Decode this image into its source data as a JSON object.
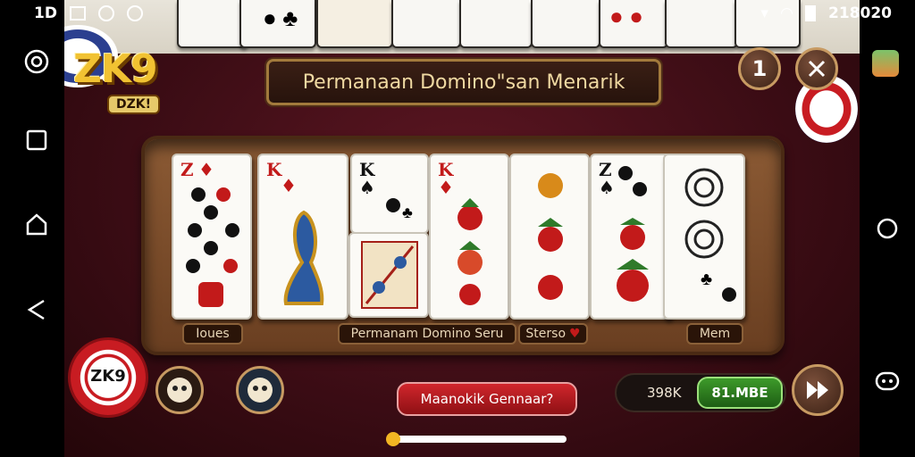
{
  "status_bar": {
    "left_text": "1D",
    "time": "218020"
  },
  "logo": {
    "main": "ZK9",
    "sub": "DZK!"
  },
  "title": "Permanaan Domino\"san Menarik",
  "top_right": {
    "number_button": "1"
  },
  "board_labels": {
    "left": "Ioues",
    "center": "Permanam Domino Seru",
    "center_right": "Sterso",
    "right": "Mem"
  },
  "dominoes": [
    {
      "rank": "Z",
      "suit": "♦",
      "suit_color": "red"
    },
    {
      "rank": "K",
      "suit": "♦",
      "suit_color": "red"
    },
    {
      "rank": "K",
      "suit": "♠",
      "suit_color": "black"
    },
    {
      "rank": "K",
      "suit": "♦",
      "suit_color": "red"
    },
    {
      "rank": "",
      "suit": "",
      "suit_color": "black"
    },
    {
      "rank": "Z",
      "suit": "♠",
      "suit_color": "black"
    },
    {
      "rank": "",
      "suit": "",
      "suit_color": "black"
    }
  ],
  "chip": {
    "label": "ZK9"
  },
  "action_button": "Maanokik Gennaar?",
  "balance": {
    "amount": "398K",
    "bet": "81.MBE"
  },
  "colors": {
    "felt": "#3a0c14",
    "wood": "#7a4b29",
    "action_red": "#b0171c",
    "bet_green": "#2d7a20",
    "progress_yellow": "#f2b623"
  },
  "progress": {
    "value": 0.02
  }
}
